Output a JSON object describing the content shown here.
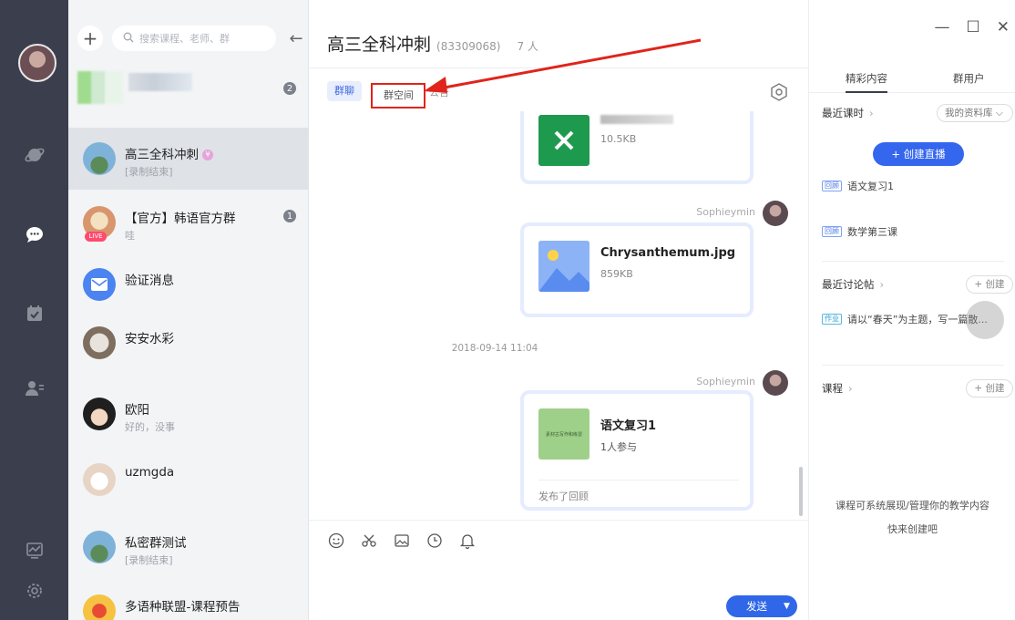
{
  "colors": {
    "accent": "#2f67e8",
    "rail": "#3b3f4d",
    "highlight_box": "#e0241b"
  },
  "sidebar_icons": [
    "avatar",
    "planet-icon",
    "chat-icon",
    "calendar-icon",
    "contacts-icon",
    "stats-icon",
    "settings-icon"
  ],
  "toolbar": {
    "search_placeholder": "搜索课程、老师、群"
  },
  "conversations": [
    {
      "name": "",
      "subtitle": "",
      "badge": "2"
    },
    {
      "name": "高三全科冲刺",
      "subtitle": "[录制结束]",
      "vip": "¥"
    },
    {
      "name": "【官方】韩语官方群",
      "subtitle": "哇",
      "badge": "1",
      "live": "LIVE"
    },
    {
      "name": "验证消息",
      "subtitle": ""
    },
    {
      "name": "安安水彩",
      "subtitle": ""
    },
    {
      "name": "欧阳",
      "subtitle": "好的，没事"
    },
    {
      "name": "uzmgda",
      "subtitle": ""
    },
    {
      "name": "私密群测试",
      "subtitle": "[录制结束]"
    },
    {
      "name": "多语种联盟-课程预告",
      "subtitle": ""
    }
  ],
  "chat": {
    "title": "高三全科冲刺",
    "group_id": "(83309068)",
    "members": "7 人",
    "tabs": {
      "chat": "群聊",
      "space": "群空间",
      "notice": "公告"
    },
    "messages": [
      {
        "file_name": "",
        "file_size": "10.5KB"
      },
      {
        "sender": "Sophieymin",
        "file_name": "Chrysanthemum.jpg",
        "file_size": "859KB"
      },
      {
        "time": "2018-09-14  11:04"
      },
      {
        "sender": "Sophieymin",
        "title": "语文复习1",
        "participants": "1人参与",
        "thumb_text": "素材古写作和练習",
        "footer": "发布了回顾"
      }
    ],
    "send_label": "发送"
  },
  "panel": {
    "tabs": {
      "featured": "精彩内容",
      "users": "群用户"
    },
    "recent_lessons": "最近课时",
    "library": "我的资料库",
    "create_live": "+ 创建直播",
    "lessons": [
      {
        "tag": "回顾",
        "title": "语文复习1"
      },
      {
        "tag": "回顾",
        "title": "数学第三课"
      }
    ],
    "recent_posts": "最近讨论帖",
    "create": "+ 创建",
    "post": {
      "tag": "作业",
      "title": "请以“春天”为主题，写一篇散..."
    },
    "courses": "课程",
    "empty_line1": "课程可系统展现/管理你的教学内容",
    "empty_line2": "快来创建吧"
  }
}
